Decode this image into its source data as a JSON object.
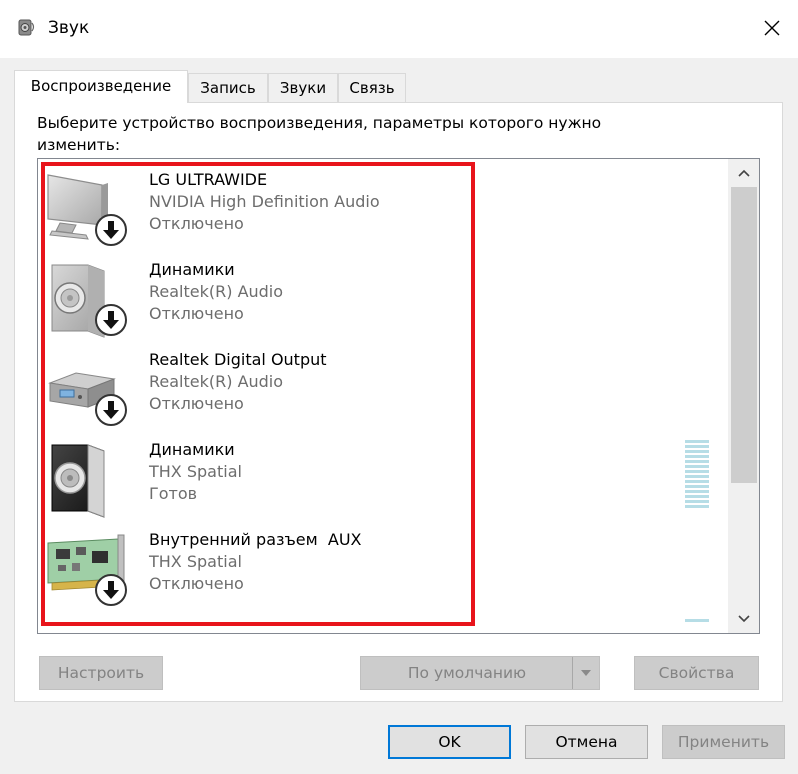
{
  "window": {
    "title": "Звук",
    "icon": "speaker-icon",
    "close_glyph": "✕"
  },
  "tabs": [
    {
      "label": "Воспроизведение",
      "active": true
    },
    {
      "label": "Запись",
      "active": false
    },
    {
      "label": "Звуки",
      "active": false
    },
    {
      "label": "Связь",
      "active": false
    }
  ],
  "panel": {
    "instructions_line1": "Выберите устройство воспроизведения, параметры которого нужно",
    "instructions_line2": "изменить:"
  },
  "devices": [
    {
      "name": "LG ULTRAWIDE",
      "driver": "NVIDIA High Definition Audio",
      "status": "Отключено",
      "icon": "monitor-icon",
      "disabled": true
    },
    {
      "name": "Динамики",
      "driver": "Realtek(R) Audio",
      "status": "Отключено",
      "icon": "speaker-device-icon",
      "disabled": true
    },
    {
      "name": "Realtek Digital Output",
      "driver": "Realtek(R) Audio",
      "status": "Отключено",
      "icon": "digital-output-icon",
      "disabled": true
    },
    {
      "name": "Динамики",
      "driver": "THX Spatial",
      "status": "Готов",
      "icon": "speaker-device-icon",
      "disabled": false
    },
    {
      "name": "Внутренний разъем  AUX",
      "driver": "THX Spatial",
      "status": "Отключено",
      "icon": "sound-card-icon",
      "disabled": true
    }
  ],
  "buttons": {
    "configure": "Настроить",
    "set_default": "По умолчанию",
    "properties": "Свойства",
    "ok": "OK",
    "cancel": "Отмена",
    "apply": "Применить"
  },
  "colors": {
    "highlight": "#e8141b",
    "accent": "#0078d7",
    "disabled_text": "#838383",
    "secondary_text": "#6d6d6d"
  }
}
